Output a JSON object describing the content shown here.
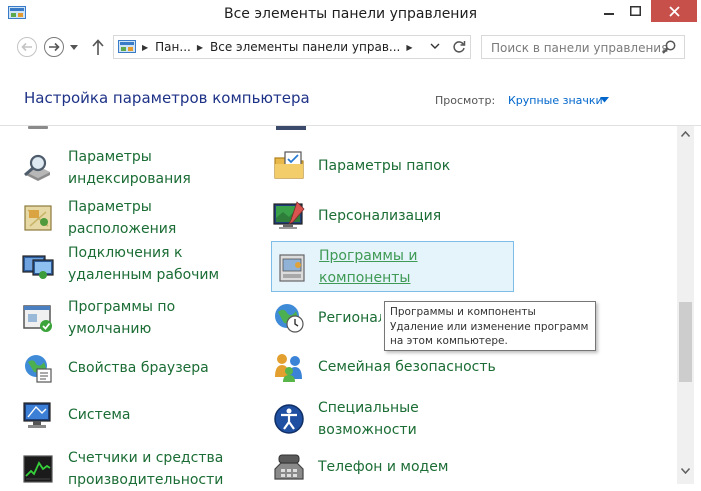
{
  "window": {
    "title": "Все элементы панели управления"
  },
  "address": {
    "crumbs": [
      "Пан...",
      "Все элементы панели управ..."
    ],
    "search_placeholder": "Поиск в панели управления"
  },
  "header": {
    "title": "Настройка параметров компьютера",
    "view_label": "Просмотр:",
    "view_value": "Крупные значки"
  },
  "items_left": [
    {
      "label": "Параметры\nиндексирования",
      "icon": "indexing-options-icon"
    },
    {
      "label": "Параметры\nрасположения",
      "icon": "location-settings-icon"
    },
    {
      "label": "Подключения к\nудаленным рабочим",
      "icon": "remote-desktop-icon"
    },
    {
      "label": "Программы по\nумолчанию",
      "icon": "default-programs-icon"
    },
    {
      "label": "Свойства браузера",
      "icon": "internet-options-icon"
    },
    {
      "label": "Система",
      "icon": "system-icon"
    },
    {
      "label": "Счетчики и средства\nпроизводительности",
      "icon": "performance-icon"
    }
  ],
  "items_right": [
    {
      "label": "Параметры папок",
      "icon": "folder-options-icon"
    },
    {
      "label": "Персонализация",
      "icon": "personalization-icon"
    },
    {
      "label": "Программы и\nкомпоненты",
      "icon": "programs-features-icon",
      "highlighted": true
    },
    {
      "label": "Региональные стандарты",
      "icon": "region-icon"
    },
    {
      "label": "Семейная безопасность",
      "icon": "family-safety-icon"
    },
    {
      "label": "Специальные\nвозможности",
      "icon": "ease-of-access-icon"
    },
    {
      "label": "Телефон и модем",
      "icon": "phone-modem-icon"
    }
  ],
  "tooltip": {
    "title": "Программы и компоненты",
    "line1": "Удаление или изменение программ",
    "line2": "на этом компьютере."
  },
  "colors": {
    "close_button": "#c7504b",
    "link": "#1b6d35",
    "header": "#1e3287"
  }
}
